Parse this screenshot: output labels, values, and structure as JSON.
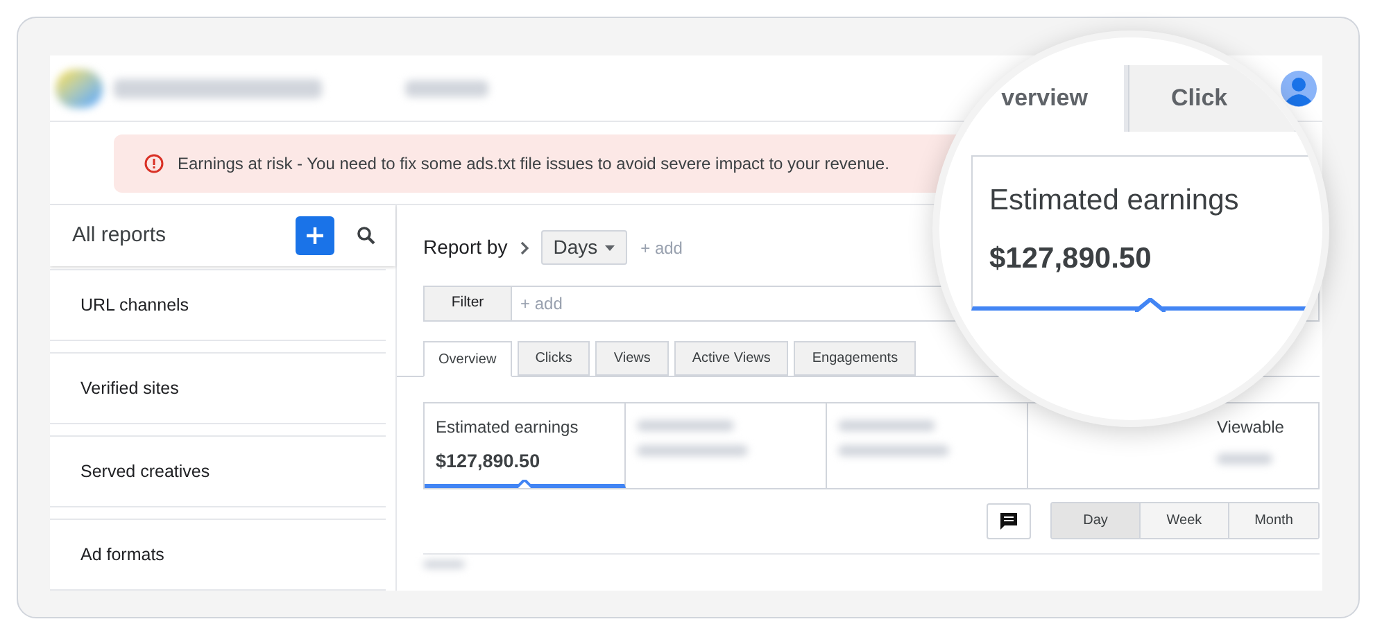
{
  "alert": {
    "text": "Earnings at risk - You need to fix some ads.txt file issues to avoid severe impact to your revenue."
  },
  "sidebar": {
    "title": "All reports",
    "items": [
      {
        "label": "URL channels"
      },
      {
        "label": "Verified sites"
      },
      {
        "label": "Served creatives"
      },
      {
        "label": "Ad formats"
      }
    ]
  },
  "report_by": {
    "label": "Report by",
    "dimension": "Days",
    "add": "+ add"
  },
  "filter": {
    "button": "Filter",
    "placeholder": "+ add"
  },
  "tabs": [
    {
      "label": "Overview",
      "selected": true
    },
    {
      "label": "Clicks",
      "selected": false
    },
    {
      "label": "Views",
      "selected": false
    },
    {
      "label": "Active Views",
      "selected": false
    },
    {
      "label": "Engagements",
      "selected": false
    }
  ],
  "metrics": [
    {
      "kind": "full",
      "label": "Estimated earnings",
      "value": "$127,890.50",
      "selected": true
    },
    {
      "kind": "blurred",
      "selected": false
    },
    {
      "kind": "blurred",
      "selected": false
    },
    {
      "kind": "partial",
      "label": "Viewable",
      "selected": false
    }
  ],
  "periods": [
    {
      "label": "Day",
      "selected": true
    },
    {
      "label": "Week",
      "selected": false
    },
    {
      "label": "Month",
      "selected": false
    }
  ],
  "magnifier": {
    "tabs": [
      {
        "label": "verview",
        "selected": true
      },
      {
        "label": "Click",
        "selected": false
      }
    ],
    "label": "Estimated earnings",
    "value": "$127,890.50"
  }
}
